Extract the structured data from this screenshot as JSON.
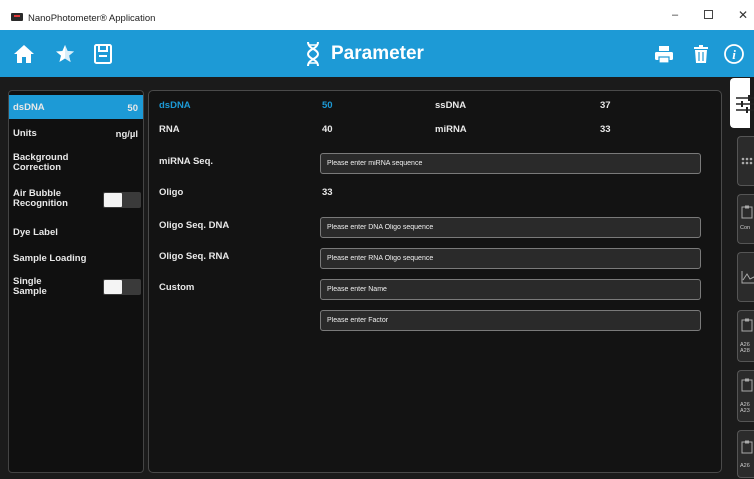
{
  "window": {
    "title": "NanoPhotometer® Application",
    "controls": {
      "minimize": "–",
      "close": "✕"
    }
  },
  "toolbar": {
    "title": "Parameter",
    "accent_color": "#1d9ad6",
    "left_icons": [
      "home-icon",
      "star-icon",
      "save-icon"
    ],
    "right_icons": [
      "print-icon",
      "trash-icon",
      "info-icon"
    ]
  },
  "settings": {
    "items": [
      {
        "label": "dsDNA",
        "value": "50",
        "active": true
      },
      {
        "label": "Units",
        "value": "ng/µl"
      },
      {
        "label": "Background Correction"
      },
      {
        "label": "Air Bubble Recognition",
        "toggle": true,
        "toggle_on": false
      },
      {
        "label": "Dye Label"
      },
      {
        "label": "Sample Loading"
      },
      {
        "label": "Single Sample",
        "toggle": true,
        "toggle_on": false
      }
    ]
  },
  "parameters": {
    "dsdna_label": "dsDNA",
    "dsdna_value": "50",
    "ssdna_label": "ssDNA",
    "ssdna_value": "37",
    "rna_label": "RNA",
    "rna_value": "40",
    "mirna_label": "miRNA",
    "mirna_value": "33",
    "mirna_seq_label": "miRNA Seq.",
    "mirna_seq_placeholder": "Please enter miRNA sequence",
    "oligo_label": "Oligo",
    "oligo_value": "33",
    "oligo_dna_label": "Oligo Seq. DNA",
    "oligo_dna_placeholder": "Please enter DNA Oligo sequence",
    "oligo_rna_label": "Oligo Seq. RNA",
    "oligo_rna_placeholder": "Please enter RNA Oligo sequence",
    "custom_label": "Custom",
    "custom_name_placeholder": "Please enter Name",
    "custom_factor_placeholder": "Please enter Factor"
  },
  "right_tabs": [
    {
      "icon": "sliders-icon",
      "text": "",
      "active": true
    },
    {
      "icon": "dots-icon",
      "text": ""
    },
    {
      "icon": "clipboard-icon",
      "text": "Con"
    },
    {
      "icon": "chart-icon",
      "text": ""
    },
    {
      "icon": "clipboard-icon",
      "text": "A26 A28"
    },
    {
      "icon": "clipboard-icon",
      "text": "A26 A23"
    },
    {
      "icon": "clipboard-icon",
      "text": "A26"
    }
  ]
}
